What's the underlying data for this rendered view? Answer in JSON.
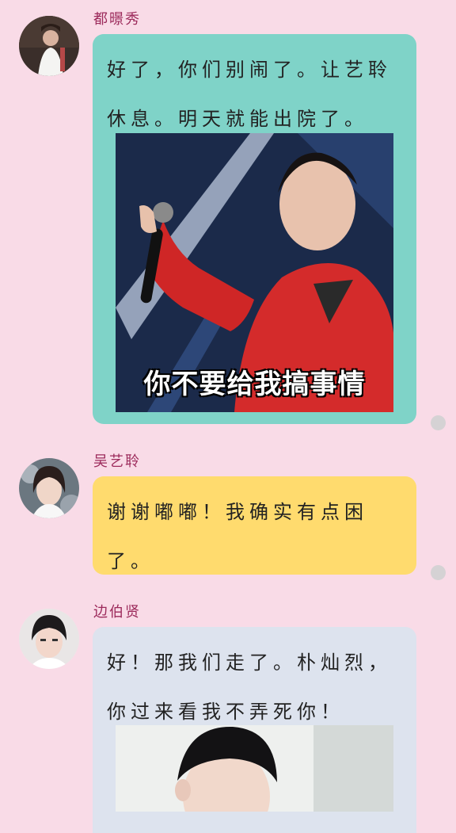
{
  "messages": [
    {
      "sender": "都暻秀",
      "text": "好了，你们别闹了。让艺聆休息。明天就能出院了。",
      "sticker_caption": "你不要给我搞事情",
      "bubble_color": "#7fd3c8"
    },
    {
      "sender": "吴艺聆",
      "text": "谢谢嘟嘟！我确实有点困了。",
      "bubble_color": "#ffdb6e"
    },
    {
      "sender": "边伯贤",
      "text": "好！那我们走了。朴灿烈，你过来看我不弄死你！",
      "bubble_color": "#dde3ee"
    }
  ],
  "icons": {
    "avatar": "user-avatar",
    "status": "read-dot-icon"
  },
  "colors": {
    "background": "#f9dbe7",
    "name": "#9c2a5b",
    "dot": "#d5d2d4"
  }
}
